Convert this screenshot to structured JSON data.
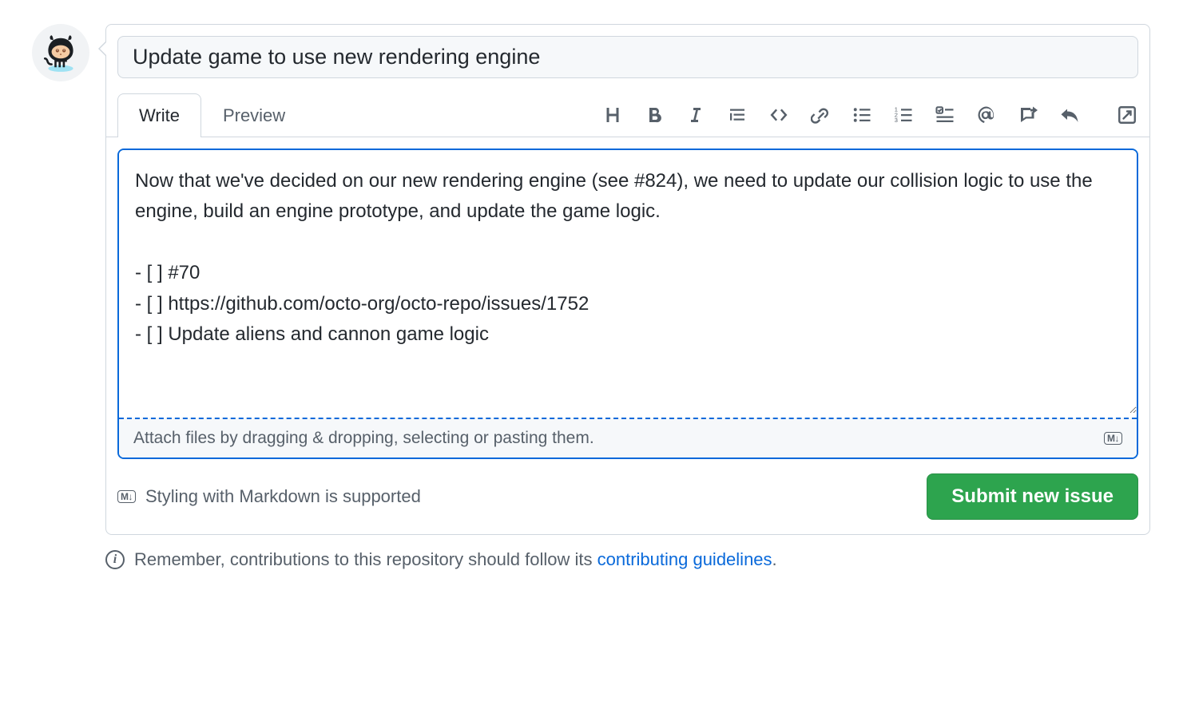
{
  "title": "Update game to use new rendering engine",
  "tabs": {
    "write": "Write",
    "preview": "Preview"
  },
  "body": "Now that we've decided on our new rendering engine (see #824), we need to update our collision logic to use the engine, build an engine prototype, and update the game logic.\n\n- [ ] #70\n- [ ] https://github.com/octo-org/octo-repo/issues/1752\n- [ ] Update aliens and cannon game logic",
  "attach_hint": "Attach files by dragging & dropping, selecting or pasting them.",
  "markdown_badge": "M↓",
  "markdown_hint": "Styling with Markdown is supported",
  "submit_label": "Submit new issue",
  "contrib_note_prefix": "Remember, contributions to this repository should follow its ",
  "contrib_link_text": "contributing guidelines",
  "contrib_note_suffix": ".",
  "toolbar_icons": {
    "heading": "heading-icon",
    "bold": "bold-icon",
    "italic": "italic-icon",
    "quote": "quote-icon",
    "code": "code-icon",
    "link": "link-icon",
    "ul": "unordered-list-icon",
    "ol": "ordered-list-icon",
    "task": "task-list-icon",
    "mention": "mention-icon",
    "reference": "cross-reference-icon",
    "reply": "reply-icon",
    "expand": "expand-icon"
  }
}
